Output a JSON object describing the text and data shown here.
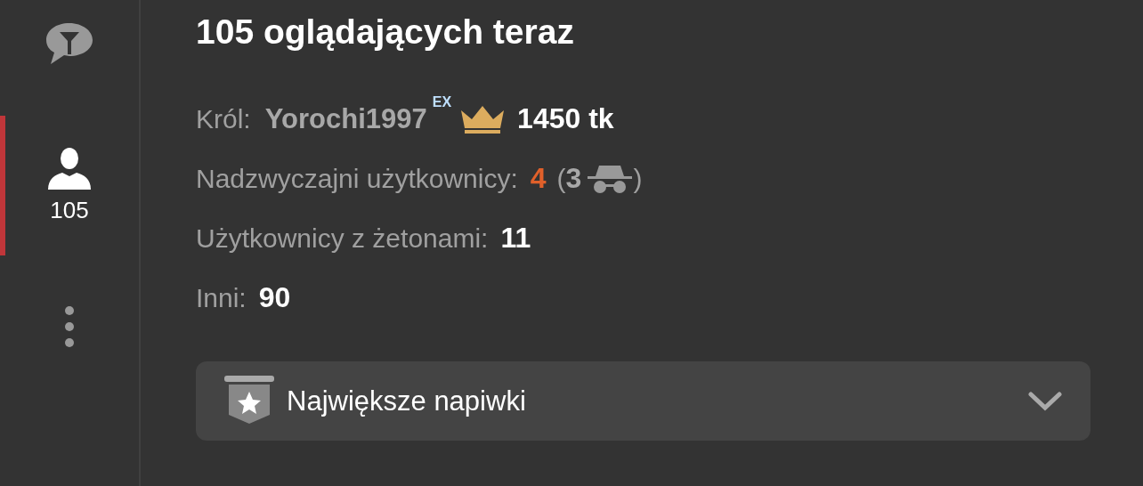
{
  "sidebar": {
    "items": [
      {
        "kind": "filter",
        "selected": false
      },
      {
        "kind": "users",
        "label": "105",
        "selected": true
      },
      {
        "kind": "more",
        "selected": false
      }
    ]
  },
  "heading": "105 oglądających teraz",
  "king": {
    "label": "Król:",
    "name": "Yorochi1997",
    "badge": "EX",
    "amount": "1450 tk"
  },
  "rows": [
    {
      "kind": "special",
      "label": "Nadzwyczajni użytkownicy:",
      "value": "4",
      "open": "(",
      "hidden": "3",
      "close": ")"
    },
    {
      "kind": "plain",
      "label": "Użytkownicy z żetonami:",
      "value": "11"
    },
    {
      "kind": "plain",
      "label": "Inni:",
      "value": "90"
    }
  ],
  "dropdown": {
    "label": "Największe napiwki",
    "expanded": false
  }
}
